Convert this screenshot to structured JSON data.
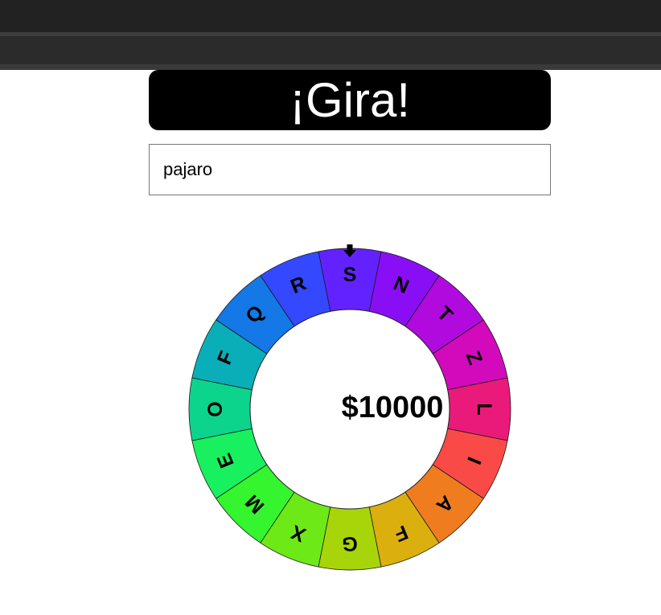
{
  "header": {
    "title": "¡Gira!"
  },
  "word_input": {
    "value": "pajaro"
  },
  "wheel": {
    "prize": "$10000",
    "pointer_icon": "arrow-down-icon",
    "segments": [
      {
        "letter": "S",
        "color": "#6222ff"
      },
      {
        "letter": "N",
        "color": "#8a0ef5"
      },
      {
        "letter": "T",
        "color": "#b00adf"
      },
      {
        "letter": "Z",
        "color": "#d20abc"
      },
      {
        "letter": "L",
        "color": "#ea1a7a"
      },
      {
        "letter": "I",
        "color": "#fa4a48"
      },
      {
        "letter": "A",
        "color": "#f07c20"
      },
      {
        "letter": "F",
        "color": "#dbb00e"
      },
      {
        "letter": "G",
        "color": "#a8d40a"
      },
      {
        "letter": "X",
        "color": "#6ee918"
      },
      {
        "letter": "M",
        "color": "#34f52e"
      },
      {
        "letter": "E",
        "color": "#18f060"
      },
      {
        "letter": "O",
        "color": "#0cd48c"
      },
      {
        "letter": "F",
        "color": "#0aaeb8"
      },
      {
        "letter": "Q",
        "color": "#1478e6"
      },
      {
        "letter": "R",
        "color": "#3448ff"
      }
    ]
  }
}
